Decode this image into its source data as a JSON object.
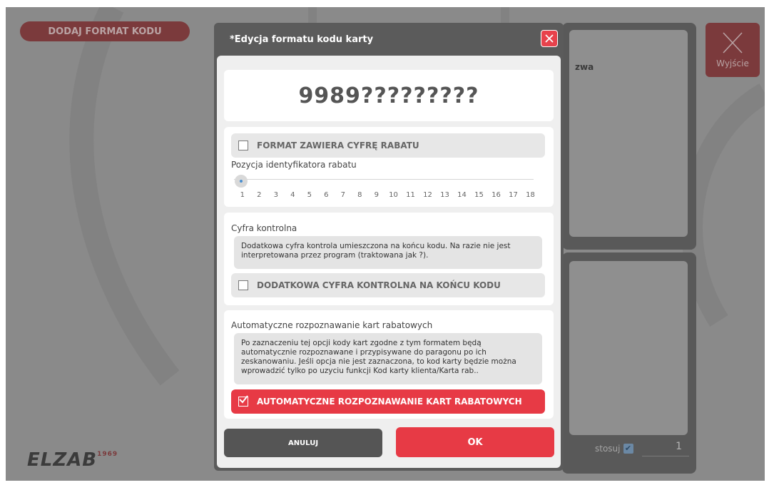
{
  "background": {
    "add_button_label": "DODAJ FORMAT KODU",
    "column_header_fragment": "zwa",
    "exit_label": "Wyjście",
    "stosuj_label": "stosuj",
    "stosuj_value": "1",
    "logo_text": "ELZAB",
    "logo_year": "1969"
  },
  "dialog": {
    "title": "*Edycja formatu kodu karty",
    "code_format": "9989?????????",
    "discount_section": {
      "checkbox_label": "FORMAT ZAWIERA CYFRĘ RABATU",
      "checked": false,
      "slider_label": "Pozycja identyfikatora rabatu",
      "slider_value": 1,
      "positions": [
        "1",
        "2",
        "3",
        "4",
        "5",
        "6",
        "7",
        "8",
        "9",
        "10",
        "11",
        "12",
        "13",
        "14",
        "15",
        "16",
        "17",
        "18"
      ]
    },
    "check_digit_section": {
      "title": "Cyfra kontrolna",
      "note": "Dodatkowa cyfra kontrola umieszczona na końcu kodu. Na razie nie jest interpretowana przez program (traktowana jak ?).",
      "checkbox_label": "DODATKOWA CYFRA KONTROLNA NA KOŃCU KODU",
      "checked": false
    },
    "auto_section": {
      "title": "Automatyczne rozpoznawanie kart rabatowych",
      "note": "Po zaznaczeniu tej opcji kody kart zgodne z tym formatem będą automatycznie rozpoznawane i przypisywane do paragonu po ich zeskanowaniu. Jeśli opcja nie jest zaznaczona, to kod karty będzie można wprowadzić tylko po uzyciu funkcji Kod karty klienta/Karta rab..",
      "checkbox_label": "AUTOMATYCZNE ROZPOZNAWANIE KART RABATOWYCH",
      "checked": true
    },
    "cancel_label": "ANULUJ",
    "ok_label": "OK"
  },
  "colors": {
    "accent": "#e73a45",
    "dialog_frame": "#5b5b5b",
    "overlay_bg": "#8a8a8a"
  }
}
